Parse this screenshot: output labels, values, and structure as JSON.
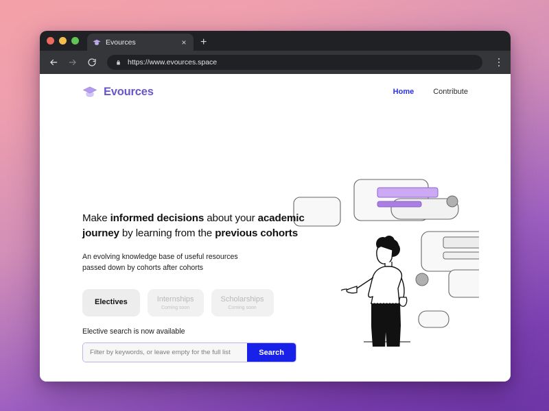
{
  "browser": {
    "traffic_lights": [
      "close",
      "minimize",
      "maximize"
    ],
    "tab": {
      "title": "Evources",
      "favicon": "graduation-cap-icon",
      "close_label": "×"
    },
    "new_tab_label": "+",
    "back_label": "back-arrow-icon",
    "forward_label": "forward-arrow-icon",
    "reload_label": "reload-icon",
    "lock_label": "lock-icon",
    "url": "https://www.evources.space",
    "menu_label": "kebab-menu-icon"
  },
  "site": {
    "brand": {
      "name": "Evources",
      "logo": "graduation-cap-icon",
      "color": "#6a55c9"
    },
    "nav": [
      {
        "label": "Home",
        "active": true
      },
      {
        "label": "Contribute",
        "active": false
      }
    ]
  },
  "hero": {
    "heading_parts": [
      {
        "text": "Make ",
        "bold": false
      },
      {
        "text": "informed decisions",
        "bold": true
      },
      {
        "text": " about your ",
        "bold": false
      },
      {
        "text": "academic journey",
        "bold": true
      },
      {
        "text": " by learning from the ",
        "bold": false
      },
      {
        "text": "previous cohorts",
        "bold": true
      }
    ],
    "heading_line1": "Make informed decisions about your academic",
    "heading_line2": "journey by learning from the previous cohorts",
    "subtitle_line1": "An evolving knowledge base of useful resources",
    "subtitle_line2": "passed down by cohorts after cohorts",
    "tabs": [
      {
        "label": "Electives",
        "sub": "",
        "state": "active"
      },
      {
        "label": "Internships",
        "sub": "Coming soon",
        "state": "disabled"
      },
      {
        "label": "Scholarships",
        "sub": "Coming soon",
        "state": "disabled"
      }
    ]
  },
  "search": {
    "note": "Elective search is now available",
    "placeholder": "Filter by keywords, or leave empty for the full list",
    "value": "",
    "button_label": "Search",
    "button_color": "#1821e8",
    "border_color": "#b9b4f0"
  },
  "illustration": {
    "name": "person-pointing-at-cards-illustration",
    "accent_light": "#c9a9f0",
    "accent_dark": "#8f61d6",
    "card_fill": "#f8f8f8",
    "bar_fill": "#ebebeb",
    "circle_fill": "#b3b3b3",
    "stroke": "#5a5a5a"
  },
  "background": {
    "gradient_from": "#f4a0a8",
    "gradient_to": "#6d35a6"
  }
}
